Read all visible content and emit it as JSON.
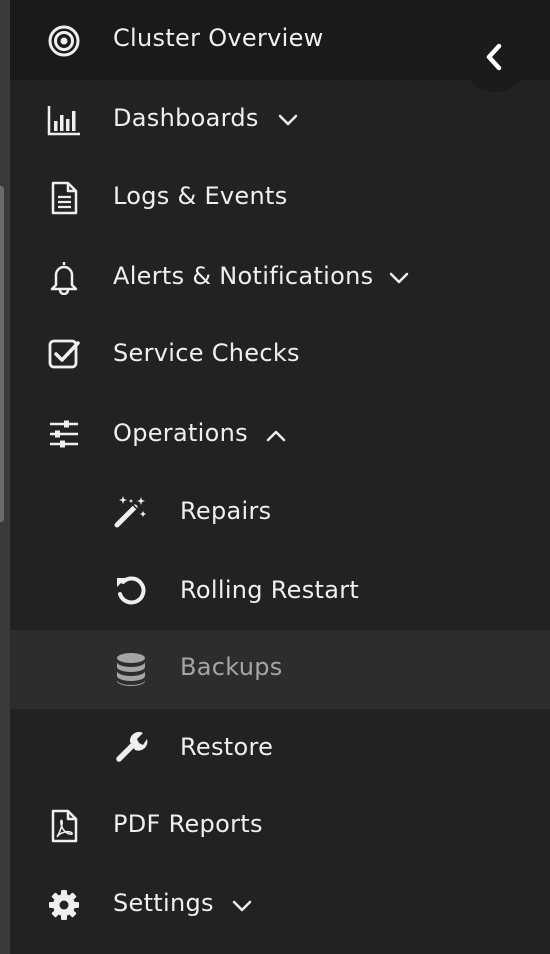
{
  "nav": {
    "items": [
      {
        "label": "Cluster Overview",
        "icon": "target-icon"
      },
      {
        "label": "Dashboards",
        "icon": "bar-chart-icon"
      },
      {
        "label": "Logs & Events",
        "icon": "document-icon"
      },
      {
        "label": "Alerts & Notifications",
        "icon": "bell-icon"
      },
      {
        "label": "Service Checks",
        "icon": "checkbox-icon"
      },
      {
        "label": "Operations",
        "icon": "sliders-icon"
      },
      {
        "label": "Repairs",
        "icon": "magic-wand-icon"
      },
      {
        "label": "Rolling Restart",
        "icon": "restart-icon"
      },
      {
        "label": "Backups",
        "icon": "database-icon"
      },
      {
        "label": "Restore",
        "icon": "wrench-icon"
      },
      {
        "label": "PDF Reports",
        "icon": "pdf-icon"
      },
      {
        "label": "Settings",
        "icon": "gear-icon"
      }
    ]
  },
  "collapse_button": {
    "icon": "chevron-left-icon"
  },
  "colors": {
    "background": "#222223",
    "active": "#2d2d2e",
    "text": "#efefef",
    "active_text": "#a5a5a5"
  }
}
